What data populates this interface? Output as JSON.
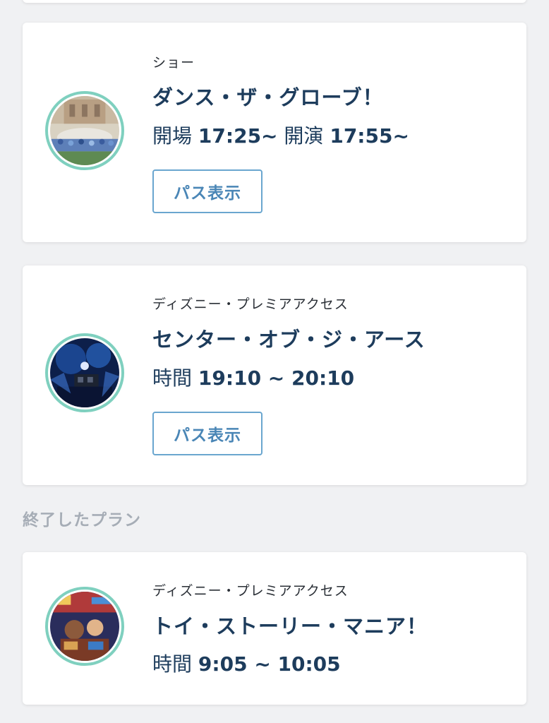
{
  "plans": [
    {
      "category": "ショー",
      "title": "ダンス・ザ・グローブ！",
      "time_label_1": "開場",
      "time_value_1": "17:25~",
      "time_label_2": "開演",
      "time_value_2": "17:55~",
      "button_label": "パス表示"
    },
    {
      "category": "ディズニー・プレミアアクセス",
      "title": "センター・オブ・ジ・アース",
      "time_label": "時間",
      "time_value": "19:10 ~ 20:10",
      "button_label": "パス表示"
    }
  ],
  "finished_section": {
    "label": "終了したプラン",
    "plans": [
      {
        "category": "ディズニー・プレミアアクセス",
        "title": "トイ・ストーリー・マニア！",
        "time_label": "時間",
        "time_value": "9:05 ~ 10:05"
      }
    ]
  },
  "colors": {
    "thumb_ring": "#7fd0bf",
    "title": "#1d3c5c",
    "button_border": "#6aa6cf",
    "button_text": "#4a86b6",
    "section_label": "#a6adb6",
    "background": "#f0f1f3"
  }
}
